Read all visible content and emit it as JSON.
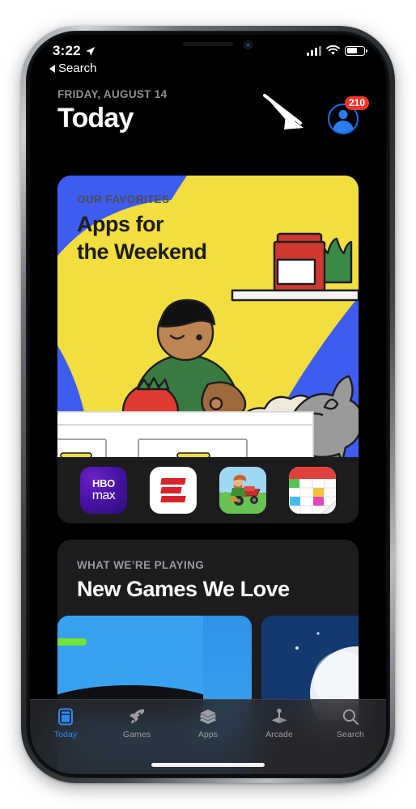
{
  "status_bar": {
    "time": "3:22",
    "location_icon": "location-arrow-icon",
    "back_label": "Search",
    "cellular_icon": "signal-bars-icon",
    "wifi_icon": "wifi-icon",
    "battery_icon": "battery-icon"
  },
  "header": {
    "date": "FRIDAY, AUGUST 14",
    "title": "Today",
    "avatar": {
      "icon": "account-avatar-icon",
      "badge_count": "210",
      "badge_color": "#f5352b",
      "accent_color": "#2a7cf0"
    },
    "annotation_arrow": "pointer-arrow-icon"
  },
  "cards": [
    {
      "eyebrow": "OUR FAVORITES",
      "headline_line1": "Apps for",
      "headline_line2": "the Weekend",
      "art_bg_color": "#3e5cf0",
      "art_accent_color": "#f2de3f",
      "apps": [
        {
          "name": "HBO Max",
          "icon": "hbo-max-icon",
          "line1": "HBO",
          "line2": "max"
        },
        {
          "name": "ESPN",
          "icon": "espn-icon"
        },
        {
          "name": "Mowing Game",
          "icon": "lawn-mower-game-icon"
        },
        {
          "name": "Calendar",
          "icon": "calendar-app-icon"
        }
      ]
    },
    {
      "eyebrow": "WHAT WE’RE PLAYING",
      "headline": "New Games We Love"
    }
  ],
  "tab_bar": {
    "items": [
      {
        "label": "Today",
        "icon": "today-card-icon",
        "active": true
      },
      {
        "label": "Games",
        "icon": "rocket-icon",
        "active": false
      },
      {
        "label": "Apps",
        "icon": "stacked-layers-icon",
        "active": false
      },
      {
        "label": "Arcade",
        "icon": "joystick-icon",
        "active": false
      },
      {
        "label": "Search",
        "icon": "search-magnifier-icon",
        "active": false
      }
    ],
    "active_color": "#2f87f5",
    "inactive_color": "#9d9da2"
  },
  "home_indicator": "home-indicator-bar"
}
